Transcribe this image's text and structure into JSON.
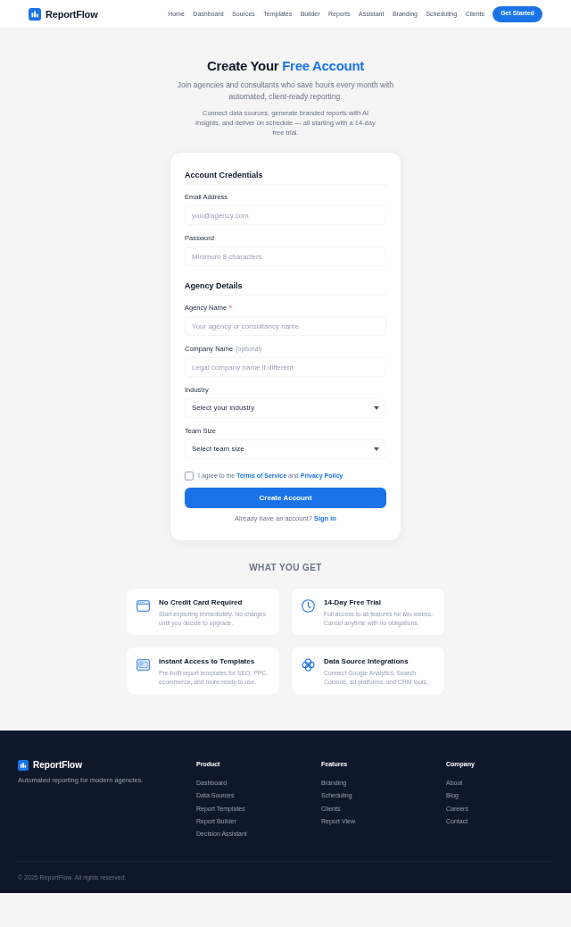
{
  "header": {
    "brand": "ReportFlow",
    "nav": [
      "Home",
      "Dashboard",
      "Sources",
      "Templates",
      "Builder",
      "Reports",
      "Assistant",
      "Branding",
      "Scheduling",
      "Clients"
    ],
    "cta": "Get Started"
  },
  "hero": {
    "title": "Create Your",
    "title_highlight": "Free Account",
    "subtitle": "Join agencies and consultants who save hours every month with automated, client-ready reporting.",
    "description": "Connect data sources, generate branded reports with AI insights, and deliver on schedule — all starting with a 14-day free trial."
  },
  "form": {
    "sections": [
      {
        "title": "Account Credentials",
        "fields": [
          {
            "kind": "input",
            "label": "Email Address",
            "placeholder": "you@agency.com"
          },
          {
            "kind": "input",
            "label": "Password",
            "placeholder": "Minimum 8 characters"
          }
        ]
      },
      {
        "title": "Agency Details",
        "fields": [
          {
            "kind": "input",
            "label": "Agency Name",
            "required_mark": "*",
            "placeholder": "Your agency or consultancy name"
          },
          {
            "kind": "input",
            "label": "Company Name",
            "hint": "(optional)",
            "placeholder": "Legal company name if different"
          },
          {
            "kind": "select",
            "label": "Industry",
            "value": "Select your industry"
          },
          {
            "kind": "select",
            "label": "Team Size",
            "value": "Select team size"
          }
        ]
      }
    ],
    "agreement": {
      "checked": false,
      "parts": [
        {
          "kind": "text",
          "text": "I agree to the"
        },
        {
          "kind": "link",
          "text": "Terms of Service"
        },
        {
          "kind": "text",
          "text": "and"
        },
        {
          "kind": "link",
          "text": "Privacy Policy"
        }
      ]
    },
    "submit": "Create Account",
    "signin": {
      "text": "Already have an account?",
      "link": "Sign in"
    }
  },
  "benefits": {
    "title": "WHAT YOU GET",
    "items": [
      {
        "title": "No Credit Card Required",
        "description": "Start exploring immediately. No charges until you decide to upgrade."
      },
      {
        "title": "14-Day Free Trial",
        "description": "Full access to all features for two weeks. Cancel anytime with no obligations."
      },
      {
        "title": "Instant Access to Templates",
        "description": "Pre-built report templates for SEO, PPC, ecommerce, and more ready to use."
      },
      {
        "title": "Data Source Integrations",
        "description": "Connect Google Analytics, Search Console, ad platforms, and CRM tools."
      }
    ]
  },
  "footer": {
    "brand": "ReportFlow",
    "tagline": "Automated reporting for modern agencies.",
    "columns": [
      {
        "title": "Product",
        "links": [
          "Dashboard",
          "Data Sources",
          "Report Templates",
          "Report Builder",
          "Decision Assistant"
        ]
      },
      {
        "title": "Features",
        "links": [
          "Branding",
          "Scheduling",
          "Clients",
          "Report View"
        ]
      },
      {
        "title": "Company",
        "links": [
          "About",
          "Blog",
          "Careers",
          "Contact"
        ]
      }
    ],
    "copyright": "© 2025 ReportFlow. All rights reserved."
  }
}
